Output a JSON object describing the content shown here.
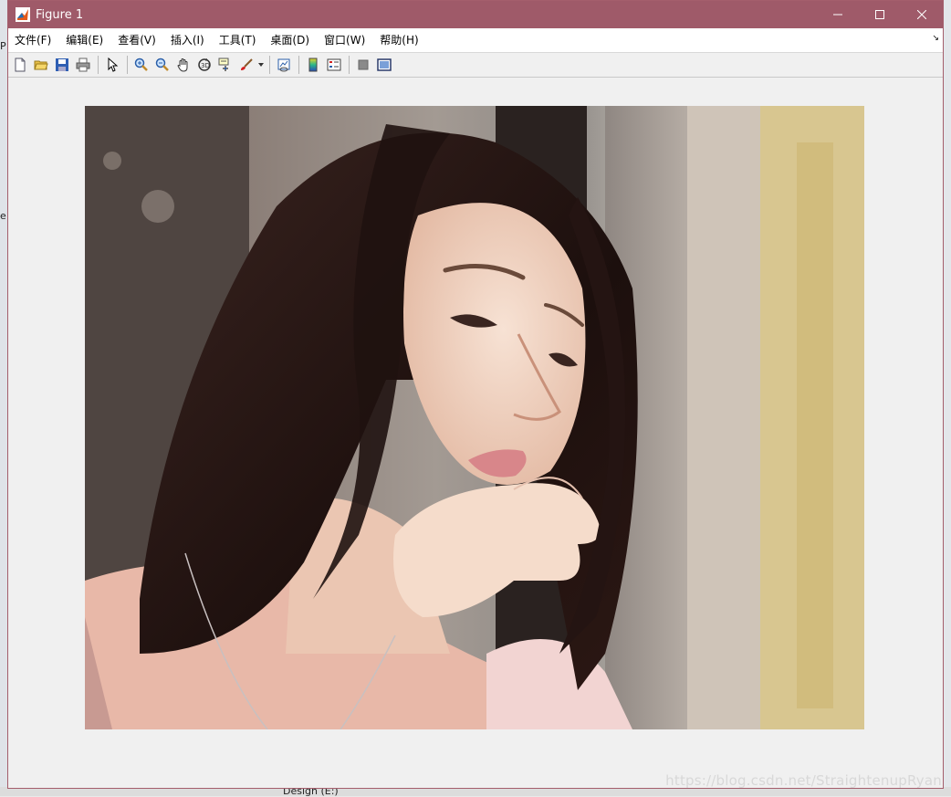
{
  "window": {
    "title": "Figure 1"
  },
  "menu": [
    {
      "label": "文件(F)"
    },
    {
      "label": "编辑(E)"
    },
    {
      "label": "查看(V)"
    },
    {
      "label": "插入(I)"
    },
    {
      "label": "工具(T)"
    },
    {
      "label": "桌面(D)"
    },
    {
      "label": "窗口(W)"
    },
    {
      "label": "帮助(H)"
    }
  ],
  "toolbar_icons": [
    "new-figure",
    "open-file",
    "save",
    "print",
    "select-arrow",
    "zoom-in",
    "zoom-out",
    "pan-hand",
    "rotate-3d",
    "data-cursor",
    "brush",
    "brush-dropdown",
    "link-plot",
    "colorbar",
    "legend",
    "hide-plot-tools",
    "show-plot-tools"
  ],
  "image": {
    "subject": "photograph"
  },
  "watermark": "https://blog.csdn.net/StraightenupRyan",
  "background": {
    "bottom_text": "Design (E:)"
  },
  "colors": {
    "titlebar": "#9f5a69",
    "border": "#a45e6c",
    "canvas": "#f0f0f0"
  }
}
